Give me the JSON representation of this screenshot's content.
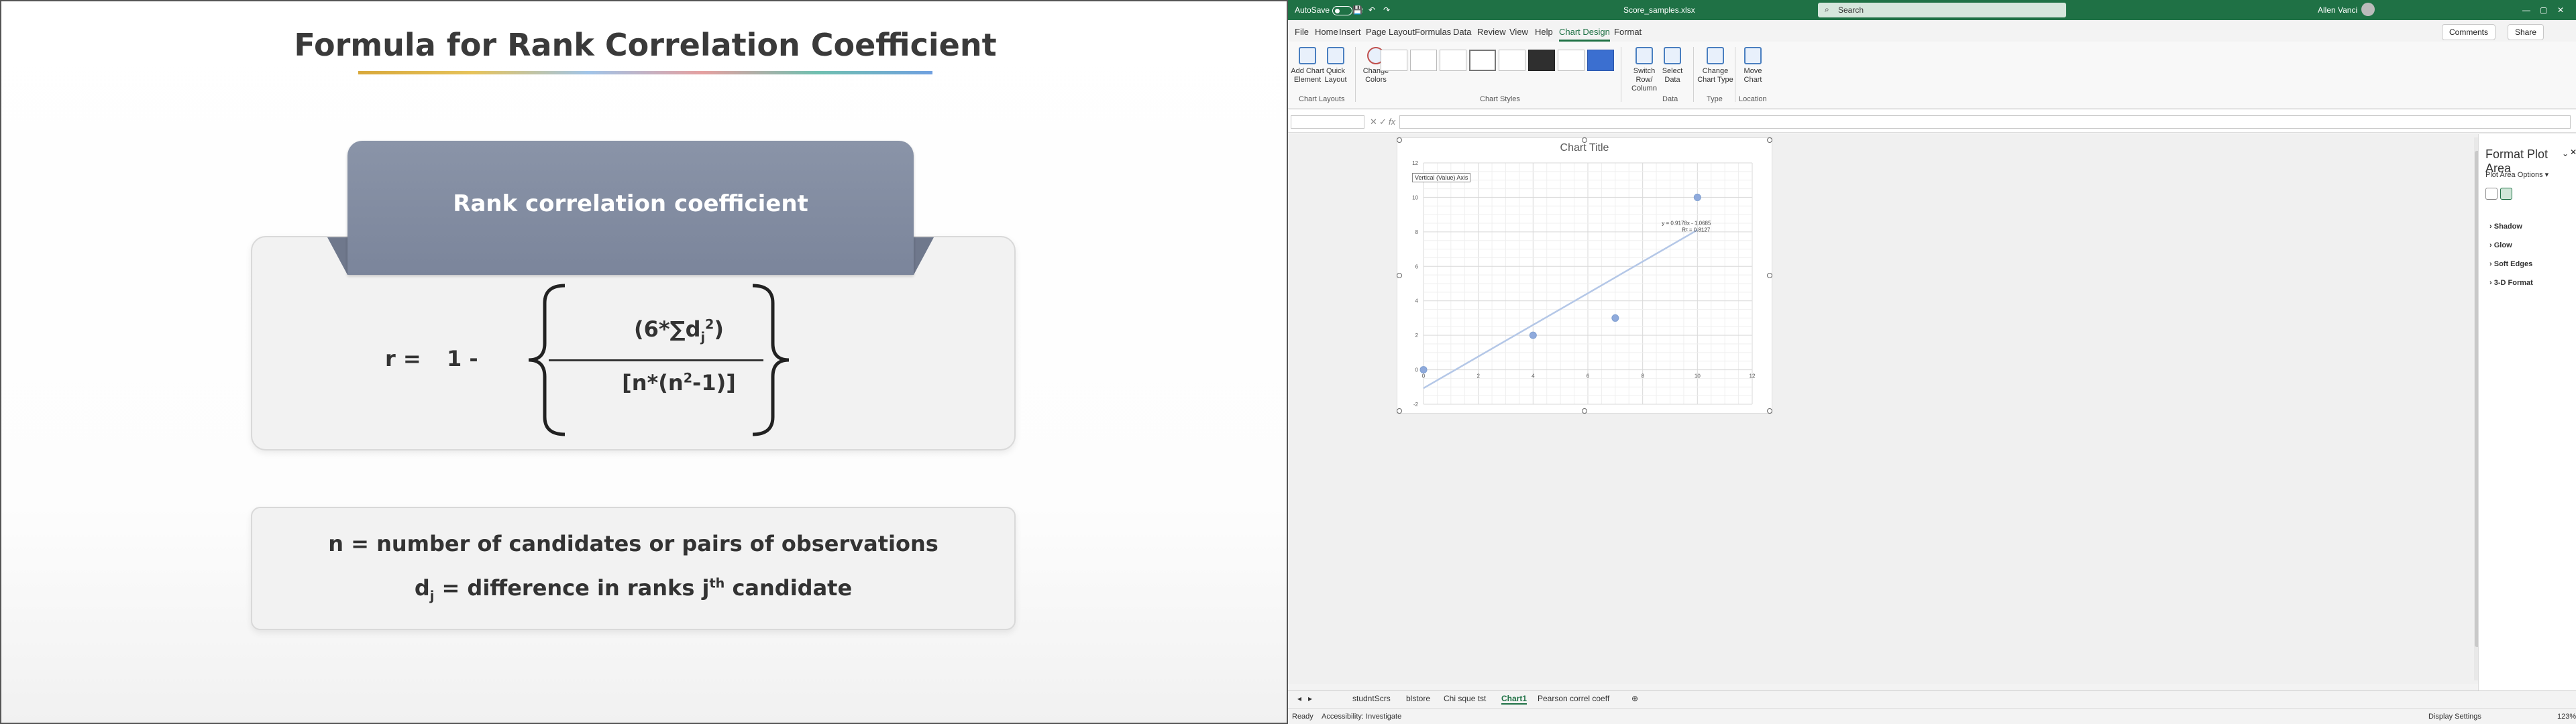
{
  "slide": {
    "title": "Formula for Rank Correlation Coefficient",
    "tab_label": "Rank correlation coefficient",
    "formula": {
      "r": "r =",
      "one_minus": "1 -",
      "numerator": "(6*∑d",
      "numerator_sub": "j",
      "numerator_sup": "2",
      "numerator_close": ")",
      "denominator": "[n*(n",
      "denominator_sup": "2",
      "denominator_close": "-1)]"
    },
    "def_n": "n = number of candidates or pairs of observations",
    "def_d_prefix": "d",
    "def_d_sub": "j",
    "def_d_mid": " = difference in ranks j",
    "def_d_sup": "th",
    "def_d_suffix": " candidate"
  },
  "excel": {
    "autosave": "AutoSave",
    "autosave_state": "Off",
    "filename": "Score_samples.xlsx",
    "search_placeholder": "Search",
    "user": "Allen Vanci",
    "menu": [
      "File",
      "Home",
      "Insert",
      "Page Layout",
      "Formulas",
      "Data",
      "Review",
      "View",
      "Help",
      "Chart Design",
      "Format"
    ],
    "active_menu": "Chart Design",
    "comments": "Comments",
    "share": "Share",
    "ribbon": {
      "add_chart_element": "Add Chart Element",
      "quick_layout": "Quick Layout",
      "change_colors": "Change Colors",
      "switch_row_column": "Switch Row/ Column",
      "select_data": "Select Data",
      "change_chart_type": "Change Chart Type",
      "move_chart": "Move Chart",
      "groups": {
        "chart_layouts": "Chart Layouts",
        "chart_styles": "Chart Styles",
        "data": "Data",
        "type": "Type",
        "location": "Location"
      }
    },
    "formula_bar": {
      "fx": "fx"
    },
    "chart": {
      "title": "Chart Title",
      "tooltip": "Vertical (Value) Axis"
    },
    "format_pane": {
      "title": "Format Plot Area",
      "options": "Plot Area Options",
      "items": [
        "Shadow",
        "Glow",
        "Soft Edges",
        "3-D Format"
      ]
    },
    "sheets": [
      "studntScrs",
      "blstore",
      "Chi sque tst",
      "Chart1",
      "Pearson correl coeff"
    ],
    "active_sheet": "Chart1",
    "status": {
      "ready": "Ready",
      "accessibility": "Accessibility: Investigate",
      "display": "Display Settings",
      "zoom": "123%"
    }
  },
  "chart_data": {
    "type": "scatter",
    "title": "Chart Title",
    "x": [
      0,
      4,
      7,
      10
    ],
    "y": [
      0,
      2,
      3,
      10
    ],
    "xlim": [
      0,
      12
    ],
    "ylim": [
      -2,
      12
    ],
    "xticks": [
      0,
      2,
      4,
      6,
      8,
      10,
      12
    ],
    "yticks": [
      -2,
      0,
      2,
      4,
      6,
      8,
      10,
      12
    ],
    "trendline": {
      "equation": "y = 0.9178x - 1.0685",
      "r2": "R² = 0.8127",
      "slope": 0.9178,
      "intercept": -1.0685
    },
    "grid": true,
    "point_color": "#8faadc",
    "line_color": "#b4c7e7"
  }
}
